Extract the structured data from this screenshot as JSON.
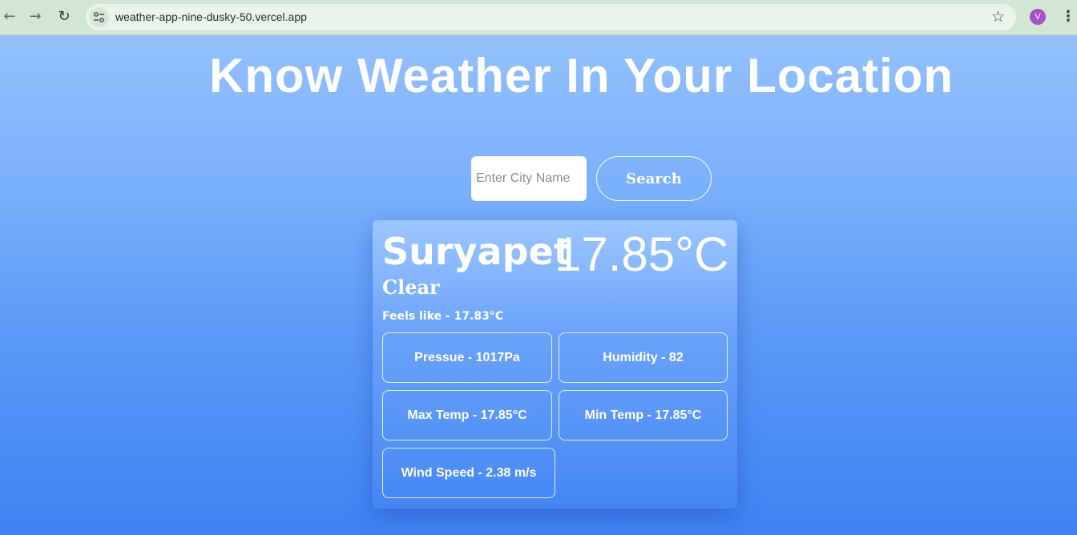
{
  "browser": {
    "url": "weather-app-nine-dusky-50.vercel.app",
    "avatar_initial": "V",
    "icons": {
      "back": "arrow-left-icon",
      "forward": "arrow-right-icon",
      "reload": "reload-icon",
      "site_info": "tune-icon",
      "bookmark": "star-icon",
      "menu": "vertical-dots-icon"
    }
  },
  "page": {
    "heading": "Know Weather In Your Location",
    "search": {
      "placeholder": "Enter City Name",
      "value": "",
      "button_label": "Search"
    },
    "weather": {
      "city": "Suryapet",
      "temperature": "17.85°C",
      "condition": "Clear",
      "feels_like": "Feels like - 17.83°C",
      "stats": {
        "pressure": "Pressue - 1017Pa",
        "humidity": "Humidity - 82",
        "max_temp": "Max Temp - 17.85°C",
        "min_temp": "Min Temp - 17.85°C",
        "wind_speed": "Wind Speed - 2.38 m/s"
      }
    }
  },
  "colors": {
    "chrome_bg": "#d2e7d3",
    "page_gradient_top": "#9ac4fd",
    "page_gradient_bottom": "#3e82f4",
    "avatar": "#a64fc9"
  }
}
